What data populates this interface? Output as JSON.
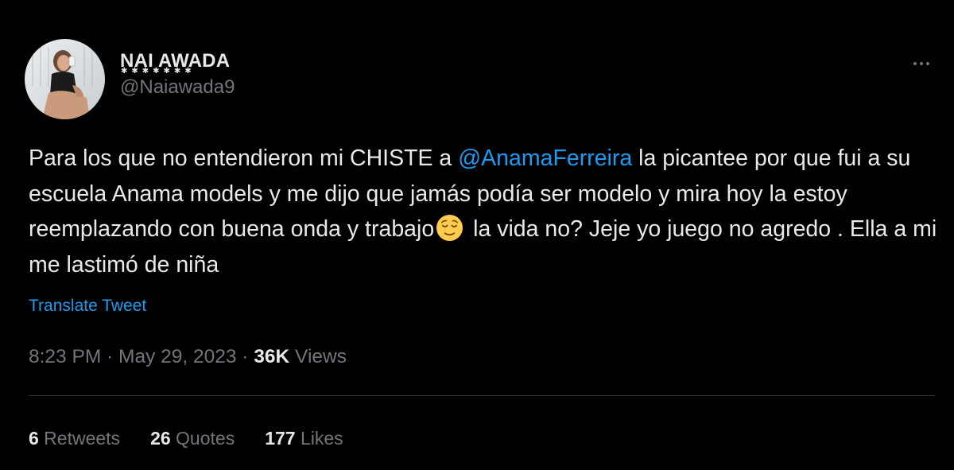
{
  "author": {
    "display_name": "NAI AWADA",
    "name_decoration": "✱✱✱✱✱✱✱",
    "handle": "@Naiawada9",
    "avatar_icon": "profile-photo"
  },
  "tweet": {
    "text_part1": "Para los que no entendieron mi CHISTE a ",
    "mention": "@AnamaFerreira",
    "text_part2": " la picantee por que fui a su escuela Anama models y me dijo que jamás podía ser modelo y mira hoy la estoy reemplazando con buena onda y trabajo",
    "emoji_icon": "relieved-face-emoji",
    "text_part3": " la vida no? Jeje yo juego no agredo . Ella a mi me lastimó de niña",
    "translate_label": "Translate Tweet"
  },
  "meta": {
    "time": "8:23 PM",
    "separator": " · ",
    "date": "May 29, 2023",
    "views_count": "36K",
    "views_label": " Views"
  },
  "stats": [
    {
      "count": "6",
      "label": " Retweets"
    },
    {
      "count": "26",
      "label": " Quotes"
    },
    {
      "count": "177",
      "label": " Likes"
    }
  ],
  "colors": {
    "background": "#000000",
    "text": "#e7e9ea",
    "secondary": "#71767b",
    "link": "#1d9bf0",
    "divider": "#2f3336"
  },
  "more_icon": "more-horizontal-icon"
}
